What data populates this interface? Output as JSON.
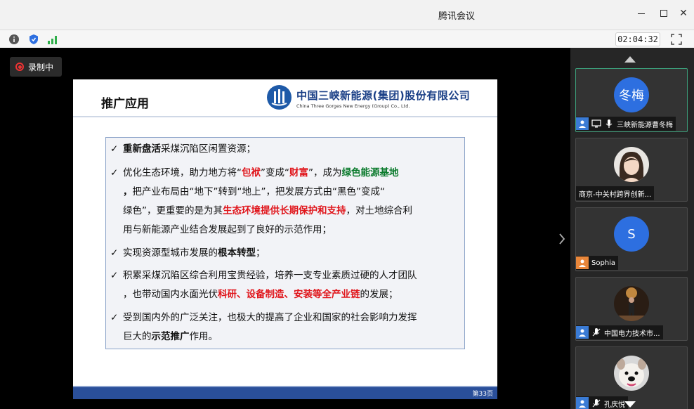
{
  "app": {
    "title": "腾讯会议",
    "timer": "02:04:32"
  },
  "recording": {
    "label": "录制中"
  },
  "slide": {
    "title": "推广应用",
    "logo_cn": "中国三峡新能源(集团)股份有限公司",
    "logo_en": "China Three Gorges New Energy (Group) Co., Ltd.",
    "page": "第33页",
    "bullets": [
      {
        "lines": [
          [
            {
              "t": "重新盘活",
              "s": "b"
            },
            {
              "t": "采煤沉陷区闲置资源；",
              "s": ""
            }
          ]
        ]
      },
      {
        "lines": [
          [
            {
              "t": "优化生态环境，助力地方将“",
              "s": ""
            },
            {
              "t": "包袱",
              "s": "red"
            },
            {
              "t": "”变成“",
              "s": ""
            },
            {
              "t": "财富",
              "s": "red"
            },
            {
              "t": "”，成为",
              "s": ""
            },
            {
              "t": "绿色能源基地",
              "s": "grn"
            }
          ],
          [
            {
              "t": "，",
              "s": "b"
            },
            {
              "t": "把产业布局由“地下”转到“地上”，把发展方式由“黑色”变成“",
              "s": ""
            }
          ],
          [
            {
              "t": "绿色”，更重要的是为其",
              "s": ""
            },
            {
              "t": "生态环境提供长期保护和支持",
              "s": "red"
            },
            {
              "t": "，对土地综合利",
              "s": ""
            }
          ],
          [
            {
              "t": "用与新能源产业结合发展起到了良好的示范作用；",
              "s": ""
            }
          ]
        ]
      },
      {
        "lines": [
          [
            {
              "t": "实现资源型城市发展的",
              "s": ""
            },
            {
              "t": "根本转型",
              "s": "b"
            },
            {
              "t": "；",
              "s": ""
            }
          ]
        ]
      },
      {
        "lines": [
          [
            {
              "t": "积累采煤沉陷区综合利用宝贵经验，培养一支专业素质过硬的人才团队",
              "s": ""
            }
          ],
          [
            {
              "t": "，也带动国内水面光伏",
              "s": ""
            },
            {
              "t": "科研、设备制造、安装等全产业链",
              "s": "red"
            },
            {
              "t": "的发展；",
              "s": ""
            }
          ]
        ]
      },
      {
        "lines": [
          [
            {
              "t": "受到国内外的广泛关注，也极大的提高了企业和国家的社会影响力发挥",
              "s": ""
            }
          ],
          [
            {
              "t": "巨大的",
              "s": ""
            },
            {
              "t": "示范推广",
              "s": "b"
            },
            {
              "t": "作用。",
              "s": ""
            }
          ]
        ]
      }
    ]
  },
  "participants": [
    {
      "avatar_text": "冬梅",
      "name": "三峡新能源曹冬梅",
      "icon": "user-icon"
    },
    {
      "avatar_text": "",
      "name": "商京-中关村跨界创新...",
      "icon": ""
    },
    {
      "avatar_text": "S",
      "name": "Sophia",
      "icon": "user-icon"
    },
    {
      "avatar_text": "",
      "name": "中国电力技术市...",
      "icon": "user-icon"
    },
    {
      "avatar_text": "",
      "name": "孔庆悦",
      "icon": "user-icon"
    }
  ],
  "colors": {
    "accent_red": "#e0151b",
    "accent_green": "#0a7a2c",
    "brand_blue": "#1e5aa8",
    "avatar_blue": "#2d6fe0"
  }
}
